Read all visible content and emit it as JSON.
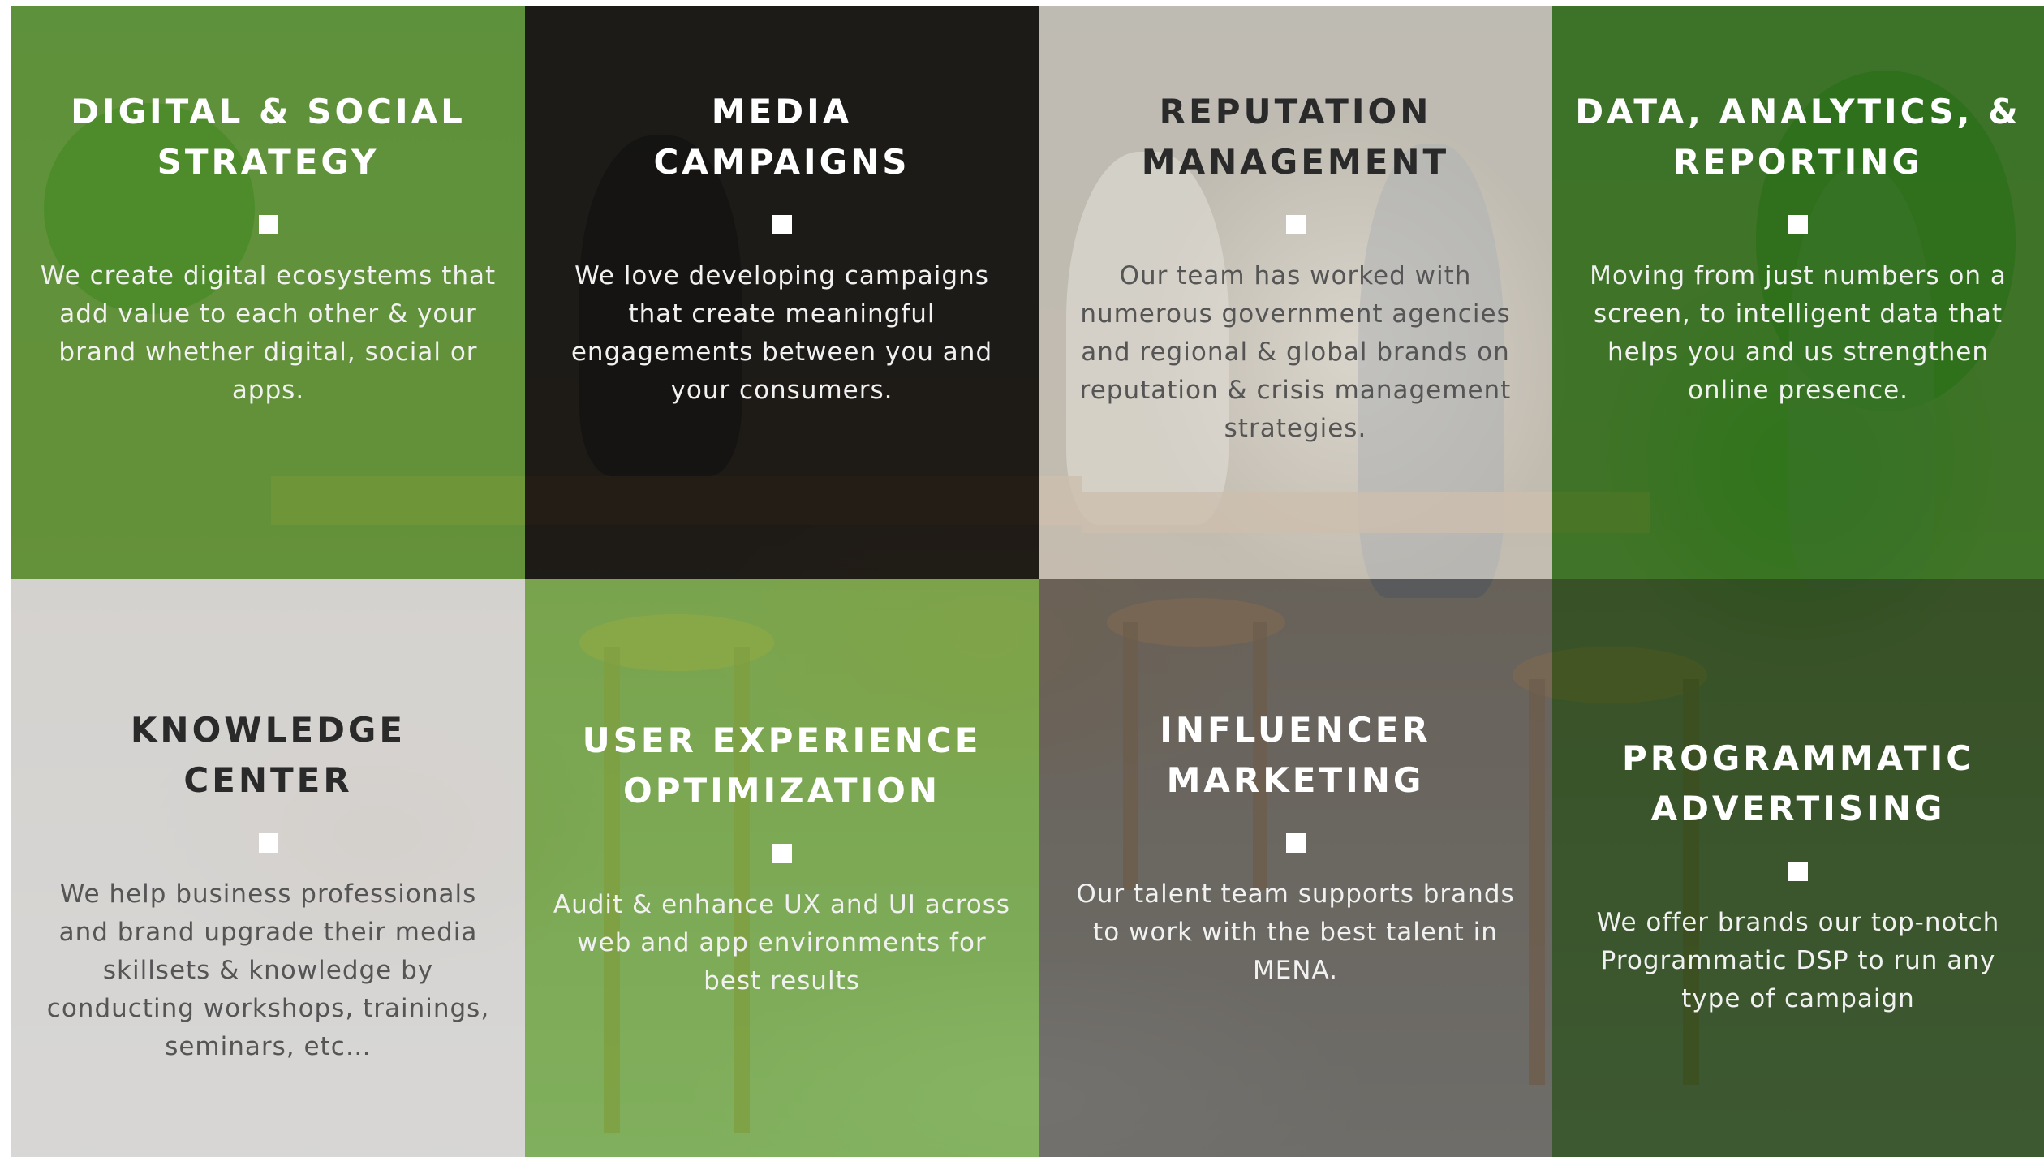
{
  "services": [
    {
      "title_line1": "DIGITAL & SOCIAL",
      "title_line2": "STRATEGY",
      "description": "We  create digital ecosystems  that add  value to each other  & your brand whether digital, social or  apps."
    },
    {
      "title_line1": "MEDIA",
      "title_line2": "CAMPAIGNS",
      "description": "We  love developing campaigns  that create meaningful engagements between you  and your consumers."
    },
    {
      "title_line1": "REPUTATION",
      "title_line2": "MANAGEMENT",
      "description": "Our team has worked  with numerous  government agencies and regional & global brands on  reputation  & crisis management  strategies."
    },
    {
      "title_line1": "DATA, ANALYTICS, &",
      "title_line2": "REPORTING",
      "description": "Moving from just numbers on  a screen,  to intelligent data  that helps  you  and us  strengthen online presence."
    },
    {
      "title_line1": "KNOWLEDGE",
      "title_line2": "CENTER",
      "description": "We  help business  professionals and brand upgrade  their media skillsets  & knowledge  by conducting workshops, trainings, seminars,  etc…"
    },
    {
      "title_line1": "USER EXPERIENCE",
      "title_line2": "OPTIMIZATION",
      "description": "Audit & enhance  UX  and  UI across  web and app environments for best results"
    },
    {
      "title_line1": "INFLUENCER",
      "title_line2": "MARKETING",
      "description": "Our talent team supports brands to work with the best talent in MENA."
    },
    {
      "title_line1": "PROGRAMMATIC",
      "title_line2": "ADVERTISING",
      "description": "We  offer brands our top-notch Programmatic DSP to run any type of campaign"
    }
  ],
  "colors": {
    "green_overlay": "#56aa28",
    "dark_overlay": "#080808",
    "light_overlay": "#e1ded7",
    "marker": "#ffffff"
  }
}
